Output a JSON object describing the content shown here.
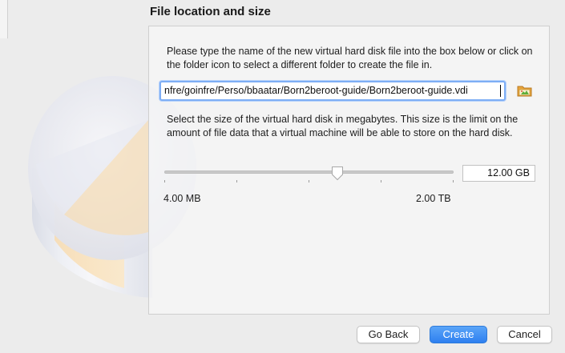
{
  "section": {
    "title": "File location and size"
  },
  "location": {
    "description": "Please type the name of the new virtual hard disk file into the box below or click on the folder icon to select a different folder to create the file in.",
    "path_value": "nfre/goinfre/Perso/bbaatar/Born2beroot-guide/Born2beroot-guide.vdi",
    "folder_icon": "folder-icon"
  },
  "size": {
    "description": "Select the size of the virtual hard disk in megabytes. This size is the limit on the amount of file data that a virtual machine will be able to store on the hard disk.",
    "value": "12.00 GB",
    "min_label": "4.00 MB",
    "max_label": "2.00 TB",
    "slider_fraction": 0.6
  },
  "buttons": {
    "back": "Go Back",
    "create": "Create",
    "cancel": "Cancel"
  },
  "colors": {
    "accent": "#2e7ff0",
    "focus_ring": "#7eaef5"
  }
}
